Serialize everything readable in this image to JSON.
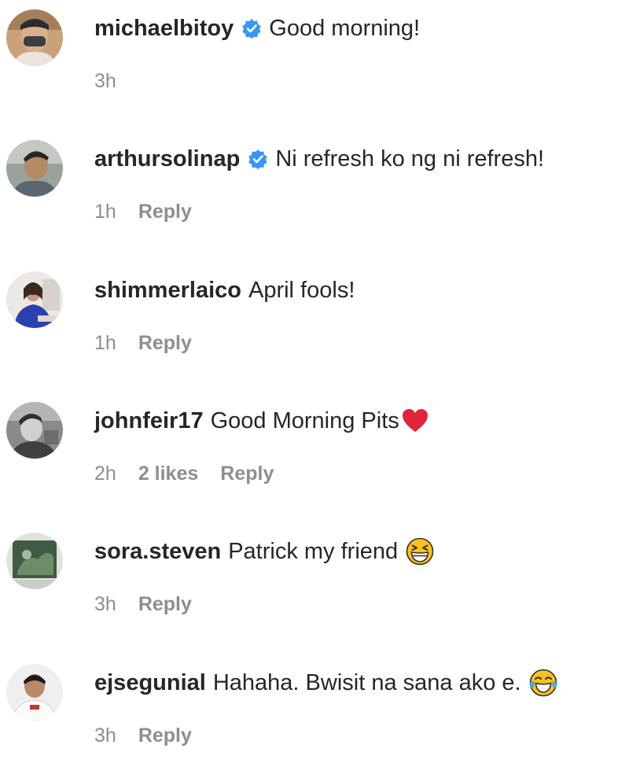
{
  "comments": [
    {
      "username": "michaelbitoy",
      "verified": true,
      "text": "Good morning!",
      "emoji": "",
      "time": "3h",
      "likes": "",
      "reply_label": "",
      "avatar_icon": "avatar-masked-man"
    },
    {
      "username": "arthursolinap",
      "verified": true,
      "text": "Ni refresh ko ng ni refresh!",
      "emoji": "",
      "time": "1h",
      "likes": "",
      "reply_label": "Reply",
      "avatar_icon": "avatar-man"
    },
    {
      "username": "shimmerlaico",
      "verified": false,
      "text": "April fools!",
      "emoji": "",
      "time": "1h",
      "likes": "",
      "reply_label": "Reply",
      "avatar_icon": "avatar-woman-blue-dress"
    },
    {
      "username": "johnfeir17",
      "verified": false,
      "text": "Good Morning Pits",
      "emoji": "red-heart",
      "time": "2h",
      "likes": "2 likes",
      "reply_label": "Reply",
      "avatar_icon": "avatar-grayscale"
    },
    {
      "username": "sora.steven",
      "verified": false,
      "text": "Patrick my friend",
      "emoji": "grinning-squinting-face",
      "time": "3h",
      "likes": "",
      "reply_label": "Reply",
      "avatar_icon": "avatar-green-painting"
    },
    {
      "username": "ejsegunial",
      "verified": false,
      "text": "Hahaha. Bwisit na sana ako e.",
      "emoji": "face-with-tears-of-joy",
      "time": "3h",
      "likes": "",
      "reply_label": "Reply",
      "avatar_icon": "avatar-man-white-shirt"
    }
  ],
  "colors": {
    "text": "#262626",
    "meta": "#8e8e8e",
    "verified": "#3897f0",
    "heart": "#e0243a",
    "emoji": "#fcc21b"
  }
}
